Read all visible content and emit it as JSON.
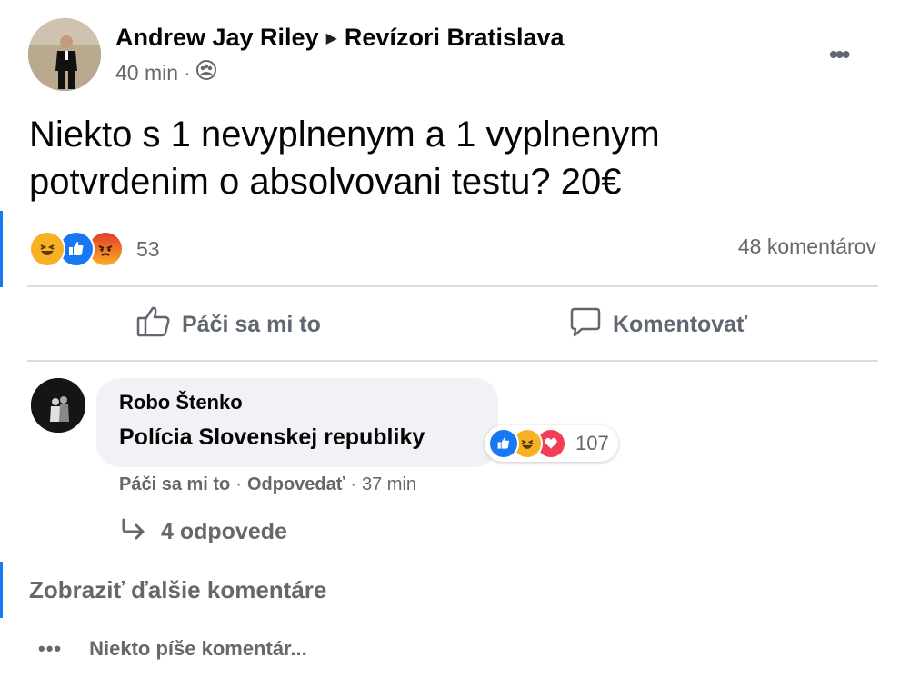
{
  "post": {
    "author": "Andrew Jay Riley",
    "group": "Revízori Bratislava",
    "time": "40 min",
    "separator": "·",
    "privacy_icon": "group-icon",
    "text": "Niekto s 1 nevyplnenym a 1 vyplnenym potvrdenim o absolvovani testu? 20€",
    "reaction_count": "53",
    "comment_count": "48 komentárov",
    "reactions": [
      "haha",
      "like",
      "angry"
    ]
  },
  "actions": {
    "like_label": "Páči sa mi to",
    "comment_label": "Komentovať"
  },
  "comment": {
    "author": "Robo Štenko",
    "text": "Polícia Slovenskej republiky",
    "reaction_count": "107",
    "reactions": [
      "like",
      "haha",
      "love"
    ],
    "like_label": "Páči sa mi to",
    "reply_label": "Odpovedať",
    "separator": "·",
    "time": "37 min",
    "replies_label": "4 odpovede"
  },
  "show_more_label": "Zobraziť ďalšie komentáre",
  "typing_label": "Niekto píše komentár...",
  "colors": {
    "accent": "#1877f2",
    "muted_text": "#65676b",
    "bubble": "#f0f2f5",
    "haha": "#f7b125",
    "angry": "#e9710f",
    "love": "#f33e58"
  }
}
